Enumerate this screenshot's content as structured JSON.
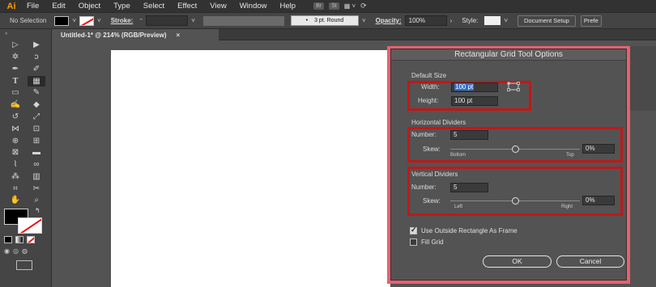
{
  "app": {
    "logo": "Ai"
  },
  "menu": [
    "File",
    "Edit",
    "Object",
    "Type",
    "Select",
    "Effect",
    "View",
    "Window",
    "Help"
  ],
  "menu_extra": {
    "badge1": "Br",
    "badge2": "St"
  },
  "control": {
    "selection": "No Selection",
    "stroke_label": "Stroke:",
    "brush": "3 pt. Round",
    "opacity_label": "Opacity:",
    "opacity_value": "100%",
    "style_label": "Style:",
    "doc_setup": "Document Setup",
    "preferences": "Prefe"
  },
  "tab": {
    "title": "Untitled-1* @ 214% (RGB/Preview)",
    "close": "×"
  },
  "dialog": {
    "title": "Rectangular Grid Tool Options",
    "default_size": {
      "section": "Default Size",
      "width_label": "Width:",
      "width_value": "100 pt",
      "height_label": "Height:",
      "height_value": "100 pt"
    },
    "horizontal": {
      "section": "Horizontal Dividers",
      "number_label": "Number:",
      "number_value": "5",
      "skew_label": "Skew:",
      "skew_value": "0%",
      "left_end": "Bottom",
      "right_end": "Top",
      "skew_position": 0.5
    },
    "vertical": {
      "section": "Vertical Dividers",
      "number_label": "Number:",
      "number_value": "5",
      "skew_label": "Skew:",
      "skew_value": "0%",
      "left_end": "Left",
      "right_end": "Right",
      "skew_position": 0.5
    },
    "use_outside_label": "Use Outside Rectangle As Frame",
    "use_outside_checked": true,
    "fill_grid_label": "Fill Grid",
    "fill_grid_checked": false,
    "ok_label": "OK",
    "cancel_label": "Cancel"
  },
  "colors": {
    "dialog_border": "#e8606f",
    "highlight": "#c01818",
    "selection_blue": "#2f6fc8",
    "ai_orange": "#ff9a00"
  }
}
